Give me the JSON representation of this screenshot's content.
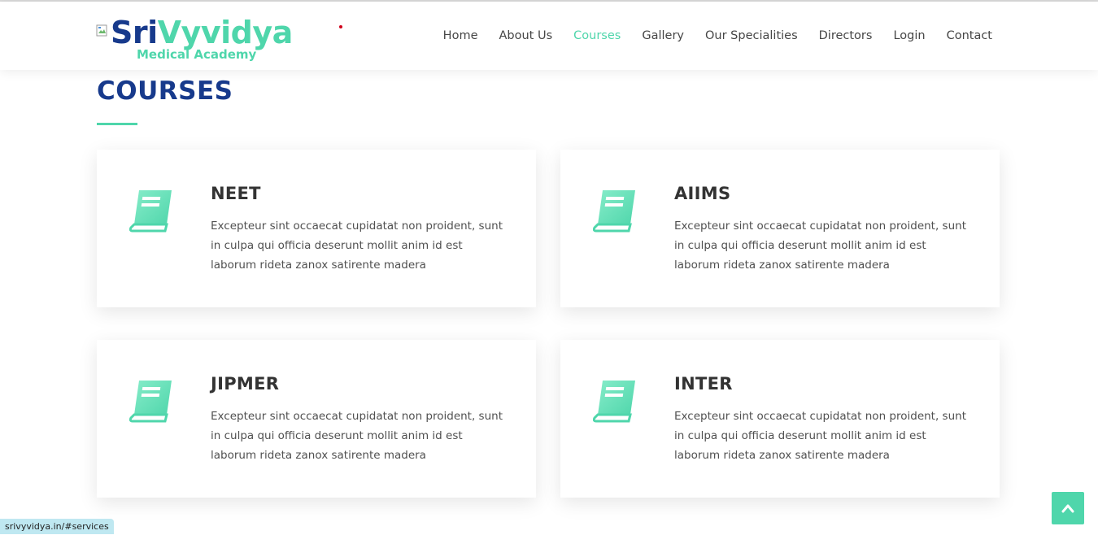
{
  "header": {
    "logo": {
      "text_primary": "Sri",
      "text_accent": "Vyvidya",
      "subtitle": "Medical Academy",
      "broken_image_icon": "broken-image-icon"
    },
    "nav": [
      {
        "label": "Home",
        "active": false
      },
      {
        "label": "About Us",
        "active": false
      },
      {
        "label": "Courses",
        "active": true
      },
      {
        "label": "Gallery",
        "active": false
      },
      {
        "label": "Our Specialities",
        "active": false
      },
      {
        "label": "Directors",
        "active": false
      },
      {
        "label": "Login",
        "active": false
      },
      {
        "label": "Contact",
        "active": false
      }
    ]
  },
  "section": {
    "title": "COURSES"
  },
  "courses": [
    {
      "title": "NEET",
      "description": "Excepteur sint occaecat cupidatat non proident, sunt in culpa qui officia deserunt mollit anim id est laborum rideta zanox satirente madera",
      "icon": "book-icon"
    },
    {
      "title": "AIIMS",
      "description": "Excepteur sint occaecat cupidatat non proident, sunt in culpa qui officia deserunt mollit anim id est laborum rideta zanox satirente madera",
      "icon": "book-icon"
    },
    {
      "title": "JIPMER",
      "description": "Excepteur sint occaecat cupidatat non proident, sunt in culpa qui officia deserunt mollit anim id est laborum rideta zanox satirente madera",
      "icon": "book-icon"
    },
    {
      "title": "INTER",
      "description": "Excepteur sint occaecat cupidatat non proident, sunt in culpa qui officia deserunt mollit anim id est laborum rideta zanox satirente madera",
      "icon": "book-icon"
    }
  ],
  "status_bar": {
    "url": "srivyvidya.in/#services"
  },
  "back_to_top": {
    "icon": "chevron-up-icon"
  },
  "colors": {
    "brand_blue": "#173a8c",
    "accent_green": "#4fd6ab",
    "text_dark": "#333333"
  }
}
